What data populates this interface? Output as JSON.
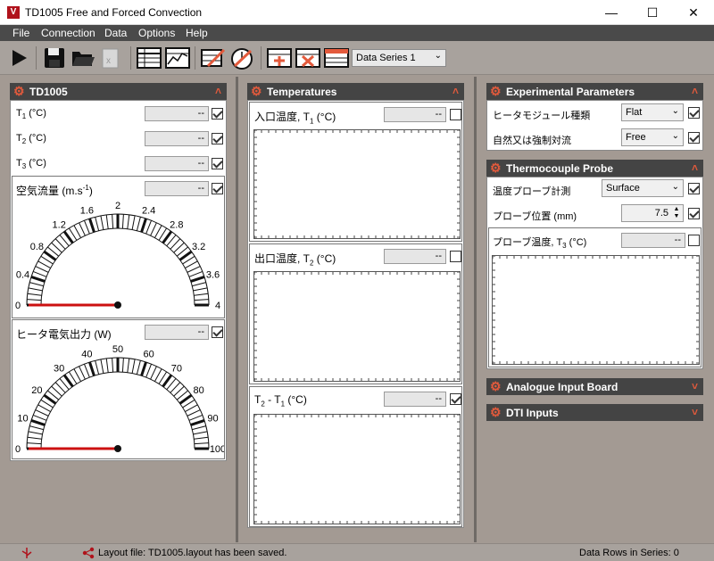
{
  "window": {
    "title": "TD1005 Free and Forced Convection",
    "minimize": "—",
    "maximize": "☐",
    "close": "✕"
  },
  "menu": [
    "File",
    "Connection",
    "Data",
    "Options",
    "Help"
  ],
  "toolbar": {
    "series_select": "Data Series 1"
  },
  "td1005": {
    "title": "TD1005",
    "rows": [
      {
        "label": "T",
        "sub": "1",
        "unit": " (°C)",
        "value": "--",
        "checked": true
      },
      {
        "label": "T",
        "sub": "2",
        "unit": " (°C)",
        "value": "--",
        "checked": true
      },
      {
        "label": "T",
        "sub": "3",
        "unit": " (°C)",
        "value": "--",
        "checked": true
      }
    ],
    "airflow": {
      "label": "空気流量",
      "unit_pre": " (m.s",
      "unit_sup": "-1",
      "unit_post": ")",
      "value": "--",
      "checked": true,
      "ticks": [
        "0",
        "0.4",
        "0.8",
        "1.2",
        "1.6",
        "2",
        "2.4",
        "2.8",
        "3.2",
        "3.6",
        "4"
      ],
      "gauge_value": 0
    },
    "heater": {
      "label": "ヒータ電気出力",
      "unit": " (W)",
      "value": "--",
      "checked": true,
      "ticks": [
        "0",
        "10",
        "20",
        "30",
        "40",
        "50",
        "60",
        "70",
        "80",
        "90",
        "100"
      ],
      "gauge_value": 0
    }
  },
  "temperatures": {
    "title": "Temperatures",
    "charts": [
      {
        "label": "入口温度, T",
        "sub": "1",
        "unit": " (°C)",
        "value": "--",
        "checked": false
      },
      {
        "label": "出口温度, T",
        "sub": "2",
        "unit": " (°C)",
        "value": "--",
        "checked": false
      },
      {
        "label": "T",
        "sub": "2",
        "mid": " - T",
        "sub2": "1",
        "unit": " (°C)",
        "value": "--",
        "checked": true
      }
    ]
  },
  "experimental": {
    "title": "Experimental Parameters",
    "rows": [
      {
        "label": "ヒータモジュール種類",
        "value": "Flat",
        "checked": true
      },
      {
        "label": "自然又は強制対流",
        "value": "Free",
        "checked": true
      }
    ]
  },
  "probe": {
    "title": "Thermocouple Probe",
    "measure_label": "温度プローブ計測",
    "measure_value": "Surface",
    "measure_checked": true,
    "position_label": "プローブ位置",
    "position_unit": " (mm)",
    "position_value": "7.5",
    "position_checked": true,
    "temp_label": "プローブ温度, T",
    "temp_sub": "3",
    "temp_unit": " (°C)",
    "temp_value": "--",
    "temp_checked": false
  },
  "analogue": {
    "title": "Analogue Input Board"
  },
  "dti": {
    "title": "DTI Inputs"
  },
  "status": {
    "message": "Layout file: TD1005.layout has been saved.",
    "rows": "Data Rows in Series: 0"
  },
  "colors": {
    "accent": "#e35a3c",
    "needle": "#cc1111",
    "header_bg": "#444444",
    "background": "#a39a93"
  }
}
